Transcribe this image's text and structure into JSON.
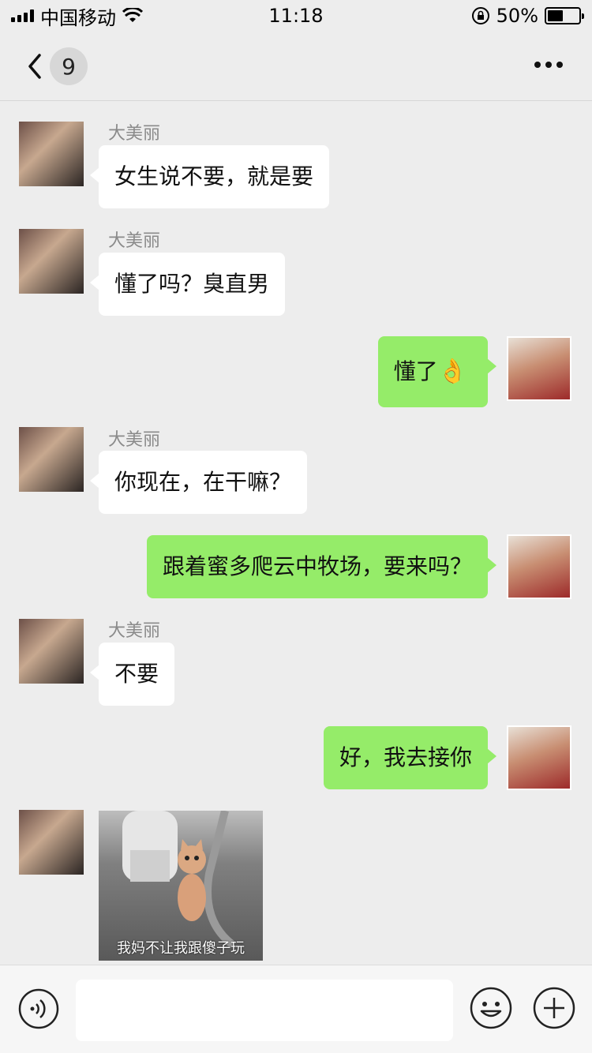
{
  "status_bar": {
    "carrier": "中国移动",
    "time": "11:18",
    "battery_percent": "50%",
    "battery_level": 0.5,
    "icons": [
      "signal-icon",
      "wifi-icon",
      "orientation-lock-icon",
      "battery-icon"
    ]
  },
  "nav": {
    "unread_count": "9",
    "icons": [
      "back-icon",
      "more-icon"
    ]
  },
  "messages": [
    {
      "side": "in",
      "sender": "大美丽",
      "text": "女生说不要，就是要"
    },
    {
      "side": "in",
      "sender": "大美丽",
      "text": "懂了吗？臭直男"
    },
    {
      "side": "out",
      "text": "懂了",
      "emoji": "👌"
    },
    {
      "side": "in",
      "sender": "大美丽",
      "text": "你现在，在干嘛？"
    },
    {
      "side": "out",
      "text": "跟着蜜多爬云中牧场，要来吗？"
    },
    {
      "side": "in",
      "sender": "大美丽",
      "text": "不要"
    },
    {
      "side": "out",
      "text": "好，我去接你"
    },
    {
      "side": "in",
      "type": "image",
      "caption": "我妈不让我跟傻子玩"
    }
  ],
  "input_bar": {
    "placeholder": "",
    "icons": [
      "voice-icon",
      "emoji-icon",
      "plus-icon"
    ]
  },
  "colors": {
    "background": "#ededed",
    "outgoing_bubble": "#95ec69",
    "incoming_bubble": "#ffffff"
  }
}
